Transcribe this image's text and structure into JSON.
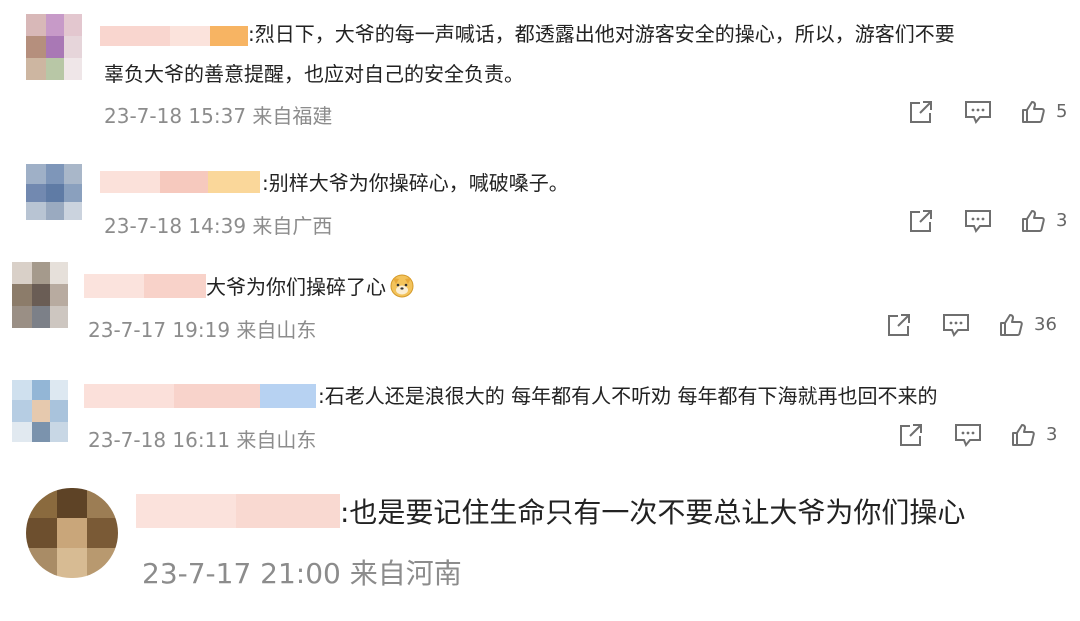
{
  "comments": [
    {
      "text_line1": ":烈日下，大爷的每一声喊话，都透露出他对游客安全的操心，所以，游客们不要",
      "text_line2": "辜负大爷的善意提醒，也应对自己的安全负责。",
      "timestamp": "23-7-18 15:37",
      "location": "来自福建",
      "likes": "5"
    },
    {
      "text": ":别样大爷为你操碎心，喊破嗓子。",
      "timestamp": "23-7-18 14:39",
      "location": "来自广西",
      "likes": "3"
    },
    {
      "text": "大爷为你们操碎了心",
      "timestamp": "23-7-17 19:19",
      "location": "来自山东",
      "likes": "36"
    },
    {
      "text": ":石老人还是浪很大的 每年都有人不听劝 每年都有下海就再也回不来的",
      "timestamp": "23-7-18 16:11",
      "location": "来自山东",
      "likes": "3"
    },
    {
      "text": ":也是要记住生命只有一次不要总让大爷为你们操心",
      "timestamp": "23-7-17 21:00",
      "location": "来自河南"
    }
  ],
  "icons": {
    "share": "share-icon",
    "comment": "comment-icon",
    "like": "like-icon",
    "emoji": "doge-emoji-icon"
  },
  "colors": {
    "timestamp": "#8c8c8c",
    "icon": "#6f6f6f"
  }
}
